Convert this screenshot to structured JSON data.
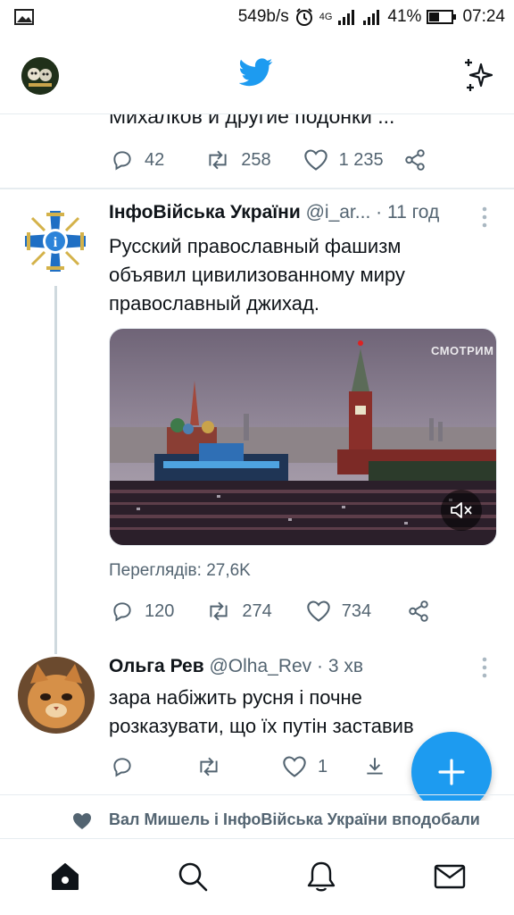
{
  "status_bar": {
    "speed": "549b/s",
    "network": "4G",
    "battery": "41%",
    "time": "07:24"
  },
  "header": {
    "logo_icon": "twitter-bird-icon",
    "sparkle_icon": "sparkle-icon",
    "brand_color": "#1d9bf0"
  },
  "prev_tweet": {
    "text_fragment": "Михалков и другие  подонки ...",
    "replies": "42",
    "retweets": "258",
    "likes": "1 235"
  },
  "tweet1": {
    "name": "ІнфоВійська України",
    "handle": "@i_ar...",
    "time": "11 год",
    "text_lines": [
      "Русский православный фашизм",
      "объявил цивилизованному миру",
      "православный джихад."
    ],
    "media_watermark": "СМОТРИМ",
    "views": "Переглядів: 27,6K",
    "replies": "120",
    "retweets": "274",
    "likes": "734"
  },
  "tweet2": {
    "name": "Ольга Рев",
    "handle": "@Olha_Rev",
    "time": "3 хв",
    "text_lines": [
      "зара набіжить русня і почне",
      "розказувати, що їх путін заставив"
    ],
    "replies": "",
    "retweets": "",
    "likes": "1"
  },
  "liked_by": "Вал Мишель і ІнфоВійська України вподобали",
  "nav": [
    "home-icon",
    "search-icon",
    "notifications-icon",
    "messages-icon"
  ]
}
